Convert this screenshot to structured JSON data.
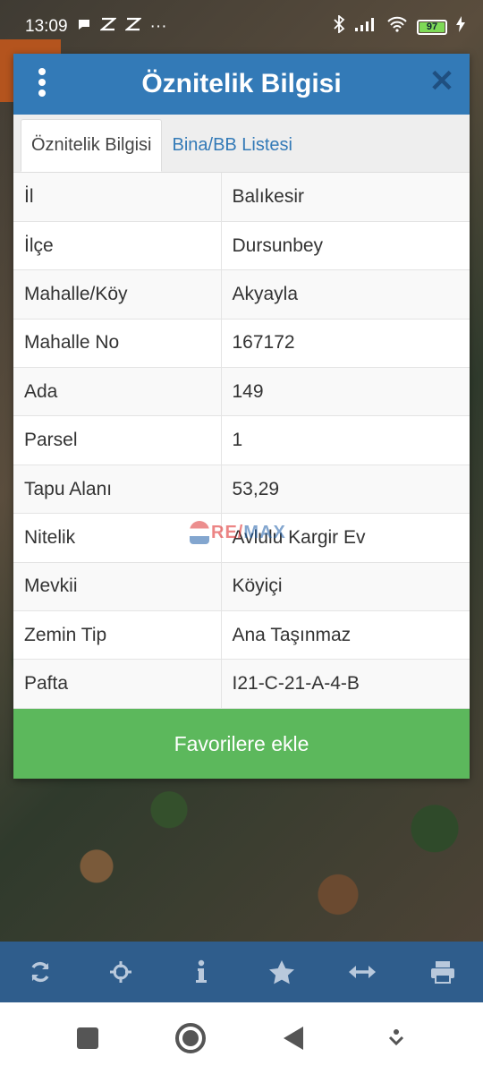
{
  "status": {
    "time": "13:09",
    "more": "···",
    "battery": "97"
  },
  "dialog": {
    "title": "Öznitelik Bilgisi",
    "tabs": [
      "Öznitelik Bilgisi",
      "Bina/BB Listesi"
    ],
    "rows": [
      {
        "key": "İl",
        "value": "Balıkesir"
      },
      {
        "key": "İlçe",
        "value": "Dursunbey"
      },
      {
        "key": "Mahalle/Köy",
        "value": "Akyayla"
      },
      {
        "key": "Mahalle No",
        "value": "167172"
      },
      {
        "key": "Ada",
        "value": "149"
      },
      {
        "key": "Parsel",
        "value": "1"
      },
      {
        "key": "Tapu Alanı",
        "value": "53,29"
      },
      {
        "key": "Nitelik",
        "value": "Avlulu Kargir Ev"
      },
      {
        "key": "Mevkii",
        "value": "Köyiçi"
      },
      {
        "key": "Zemin Tip",
        "value": "Ana Taşınmaz"
      },
      {
        "key": "Pafta",
        "value": "I21-C-21-A-4-B"
      }
    ],
    "favorite_button": "Favorilere ekle"
  },
  "watermark": {
    "part1": "RE/",
    "part2": "MAX"
  },
  "toolbar_icons": [
    "refresh-icon",
    "crosshair-icon",
    "info-icon",
    "star-icon",
    "measure-icon",
    "print-icon"
  ],
  "colors": {
    "header": "#337ab7",
    "button": "#5cb85c",
    "toolbar": "#2f5d8c"
  }
}
